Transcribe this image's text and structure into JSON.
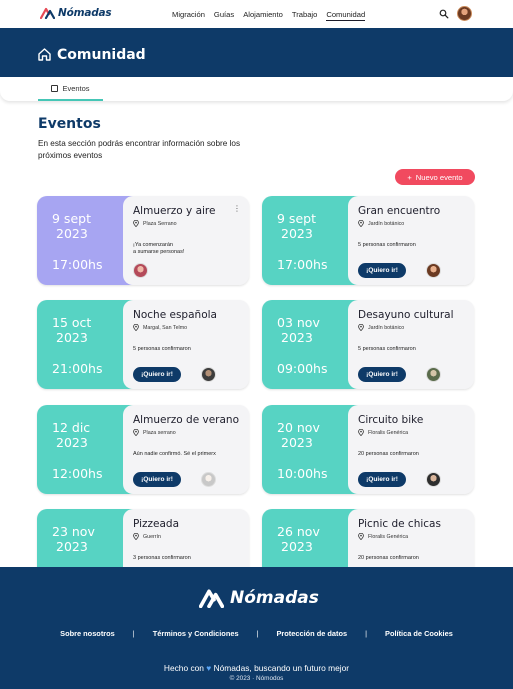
{
  "brand": {
    "name": "Nómadas"
  },
  "nav": {
    "links": [
      "Migración",
      "Guías",
      "Alojamiento",
      "Trabajo",
      "Comunidad"
    ],
    "active_index": 4
  },
  "hero": {
    "title": "Comunidad"
  },
  "tabs": [
    {
      "label": "Eventos"
    }
  ],
  "section": {
    "title": "Eventos",
    "description": "En esta sección podrás encontrar información sobre los próximos eventos",
    "new_button": "Nuevo evento",
    "new_button_icon": "+"
  },
  "events": [
    {
      "day": "9  sept",
      "year": "2023",
      "time": "17:00hs",
      "title": "Almuerzo y aire",
      "location": "Plaza Serrano",
      "message": "¡Ya comenzarán\na sumarse personas!",
      "button": "",
      "color": "#a7a5f2",
      "avatar": "av1",
      "menu": true
    },
    {
      "day": "9  sept",
      "year": "2023",
      "time": "17:00hs",
      "title": "Gran encuentro",
      "location": "Jardín botánico",
      "message": "5 personas confirmaron",
      "button": "¡Quiero ir!",
      "color": "#57d3c3",
      "avatar": "av2",
      "menu": false
    },
    {
      "day": "15  oct",
      "year": "2023",
      "time": "21:00hs",
      "title": "Noche española",
      "location": "Margal, San Telmo",
      "message": "5 personas confirmaron",
      "button": "¡Quiero ir!",
      "color": "#57d3c3",
      "avatar": "av3",
      "menu": false
    },
    {
      "day": "03  nov",
      "year": "2023",
      "time": "09:00hs",
      "title": "Desayuno cultural",
      "location": "Jardín botánico",
      "message": "5 personas confirmaron",
      "button": "¡Quiero ir!",
      "color": "#57d3c3",
      "avatar": "av4",
      "menu": false
    },
    {
      "day": "12 dic",
      "year": "2023",
      "time": "12:00hs",
      "title": "Almuerzo de verano",
      "location": "Plaza serrano",
      "message": "Aún nadie confirmó. Sé el primerx",
      "button": "¡Quiero ir!",
      "color": "#57d3c3",
      "avatar": "av5",
      "menu": false
    },
    {
      "day": "20 nov",
      "year": "2023",
      "time": "10:00hs",
      "title": "Circuito bike",
      "location": "Floralis Genérica",
      "message": "20 personas confirmaron",
      "button": "¡Quiero ir!",
      "color": "#57d3c3",
      "avatar": "av6",
      "menu": false
    },
    {
      "day": "23 nov",
      "year": "2023",
      "time": "",
      "title": "Pizzeada",
      "location": "Guerrín",
      "message": "3 personas confirmaron",
      "button": "",
      "color": "#57d3c3",
      "avatar": "",
      "menu": false
    },
    {
      "day": "26 nov",
      "year": "2023",
      "time": "",
      "title": "Picnic de chicas",
      "location": "Floralis Genérica",
      "message": "20 personas confirmaron",
      "button": "",
      "color": "#57d3c3",
      "avatar": "",
      "menu": false
    }
  ],
  "footer": {
    "brand": "Nómadas",
    "links": [
      "Sobre nosotros",
      "Términos y Condiciones",
      "Protección de datos",
      "Política de Cookies"
    ],
    "separator": "|",
    "tagline_before": "Hecho con",
    "tagline_after": "Nómadas, buscando un futuro mejor",
    "copyright": "© 2023 · Nómodos"
  },
  "icons": {
    "logo": "nomadas-logo-icon",
    "search": "search-icon",
    "home": "home-icon",
    "calendar": "calendar-icon",
    "pin": "location-pin-icon",
    "heart": "heart-icon"
  },
  "colors": {
    "primary": "#0e3a68",
    "accent_teal": "#57d3c3",
    "accent_purple": "#a7a5f2",
    "accent_red": "#f14a5f"
  }
}
